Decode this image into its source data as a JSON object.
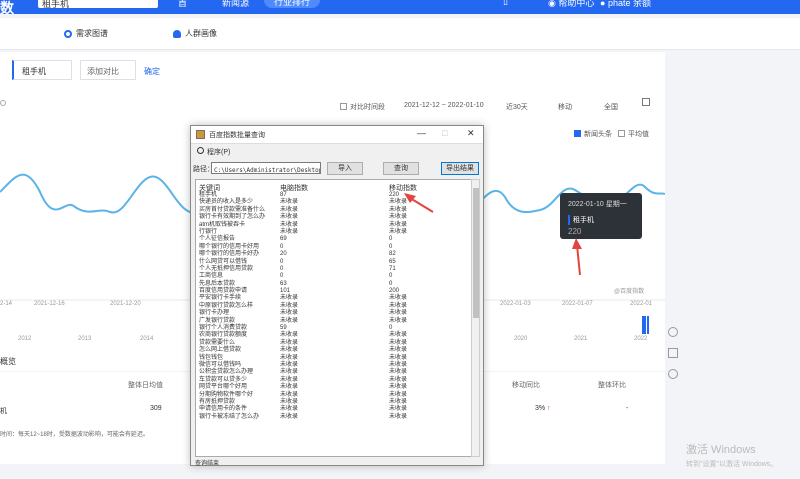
{
  "topbar": {
    "logo": "数",
    "search_value": "租手机",
    "search_button": "搜索",
    "nav_1": "首",
    "nav_2": "新闻源",
    "nav_active": "行业排行",
    "help": "帮助中心",
    "user": "phate 余额"
  },
  "tabs": {
    "trend": "需求图谱",
    "portrait": "人群画像"
  },
  "compare": {
    "keyword": "租手机",
    "add": "添加对比",
    "confirm": "确定"
  },
  "filters": {
    "compare_time": "对比时间段",
    "date_range": "2021-12-12 ~ 2022-01-10",
    "days": "近30天",
    "device": "移动",
    "region": "全国",
    "avg_checkbox": "平均值",
    "news_checkbox": "新闻头条"
  },
  "chart_axis": {
    "x_labels": [
      "2-14",
      "2021-12-16",
      "2021-12-20",
      "2022-01-03",
      "2022-01-07",
      "2022-01"
    ],
    "year_labels": [
      "2012",
      "2013",
      "2014",
      "2020",
      "2021",
      "2022"
    ],
    "credit": "@百度指数"
  },
  "tooltip": {
    "date": "2022-01-10 星期一",
    "name": "租手机",
    "value": "220"
  },
  "overview": {
    "title": "概览",
    "col_avg": "整体日均值",
    "col_yoy": "移动同比",
    "col_mom": "整体环比",
    "row_keyword": "机",
    "row_value": "309",
    "row_pct": "3%",
    "row_dash": "-",
    "note": "时间：每天12~18时，受数据波动影响，可能会有延迟。"
  },
  "dialog": {
    "title": "百度指数批量查询",
    "menu": "程序(P)",
    "path_label": "路径：",
    "path_value": "C:\\Users\\Administrator\\Desktop\\租",
    "import_button": "导入",
    "query_button": "查询",
    "export_button": "导出结果",
    "col_keyword": "关键词",
    "col_pc": "电脑指数",
    "col_mobile": "移动指数",
    "status": "查询结束"
  },
  "rows": [
    [
      "租手机",
      "87",
      "220"
    ],
    [
      "快递员的收入是多少",
      "未收录",
      "未收录"
    ],
    [
      "买房首付贷款需准备什么",
      "未收录",
      "未收录"
    ],
    [
      "银行卡有效期到了怎么办",
      "未收录",
      "未收录"
    ],
    [
      "atm机取钱被吞卡",
      "未收录",
      "未收录"
    ],
    [
      "行银行",
      "未收录",
      "未收录"
    ],
    [
      "个人征信报告",
      "69",
      "0"
    ],
    [
      "哪个银行的信用卡好用",
      "0",
      "0"
    ],
    [
      "哪个银行的信用卡好办",
      "20",
      "82"
    ],
    [
      "什么网贷可以借钱",
      "0",
      "65"
    ],
    [
      "个人无抵押信用贷款",
      "0",
      "71"
    ],
    [
      "工商信息",
      "0",
      "0"
    ],
    [
      "先息后本贷款",
      "63",
      "0"
    ],
    [
      "百度信用贷款申请",
      "101",
      "200"
    ],
    [
      "平安银行卡手续",
      "未收录",
      "未收录"
    ],
    [
      "中原银行贷款怎么样",
      "未收录",
      "未收录"
    ],
    [
      "银行卡办理",
      "未收录",
      "未收录"
    ],
    [
      "广发银行贷款",
      "未收录",
      "未收录"
    ],
    [
      "银行个人消费贷款",
      "59",
      "0"
    ],
    [
      "农商银行贷款额度",
      "未收录",
      "未收录"
    ],
    [
      "贷款需要什么",
      "未收录",
      "未收录"
    ],
    [
      "怎么网上借贷款",
      "未收录",
      "未收录"
    ],
    [
      "钱包钱包",
      "未收录",
      "未收录"
    ],
    [
      "微信可以借钱吗",
      "未收录",
      "未收录"
    ],
    [
      "公积金贷款怎么办理",
      "未收录",
      "未收录"
    ],
    [
      "车贷款可以贷多少",
      "未收录",
      "未收录"
    ],
    [
      "网贷平台哪个好用",
      "未收录",
      "未收录"
    ],
    [
      "分期购物软件哪个好",
      "未收录",
      "未收录"
    ],
    [
      "有房抵押贷款",
      "未收录",
      "未收录"
    ],
    [
      "申请信用卡的条件",
      "未收录",
      "未收录"
    ],
    [
      "银行卡被冻结了怎么办",
      "未收录",
      "未收录"
    ]
  ],
  "watermark": {
    "line1": "激活 Windows",
    "line2": "转到\"设置\"以激活 Windows。"
  },
  "colors": {
    "brand": "#2468f2",
    "chart_line": "#5ab4e8",
    "arrow": "#e0463f"
  }
}
